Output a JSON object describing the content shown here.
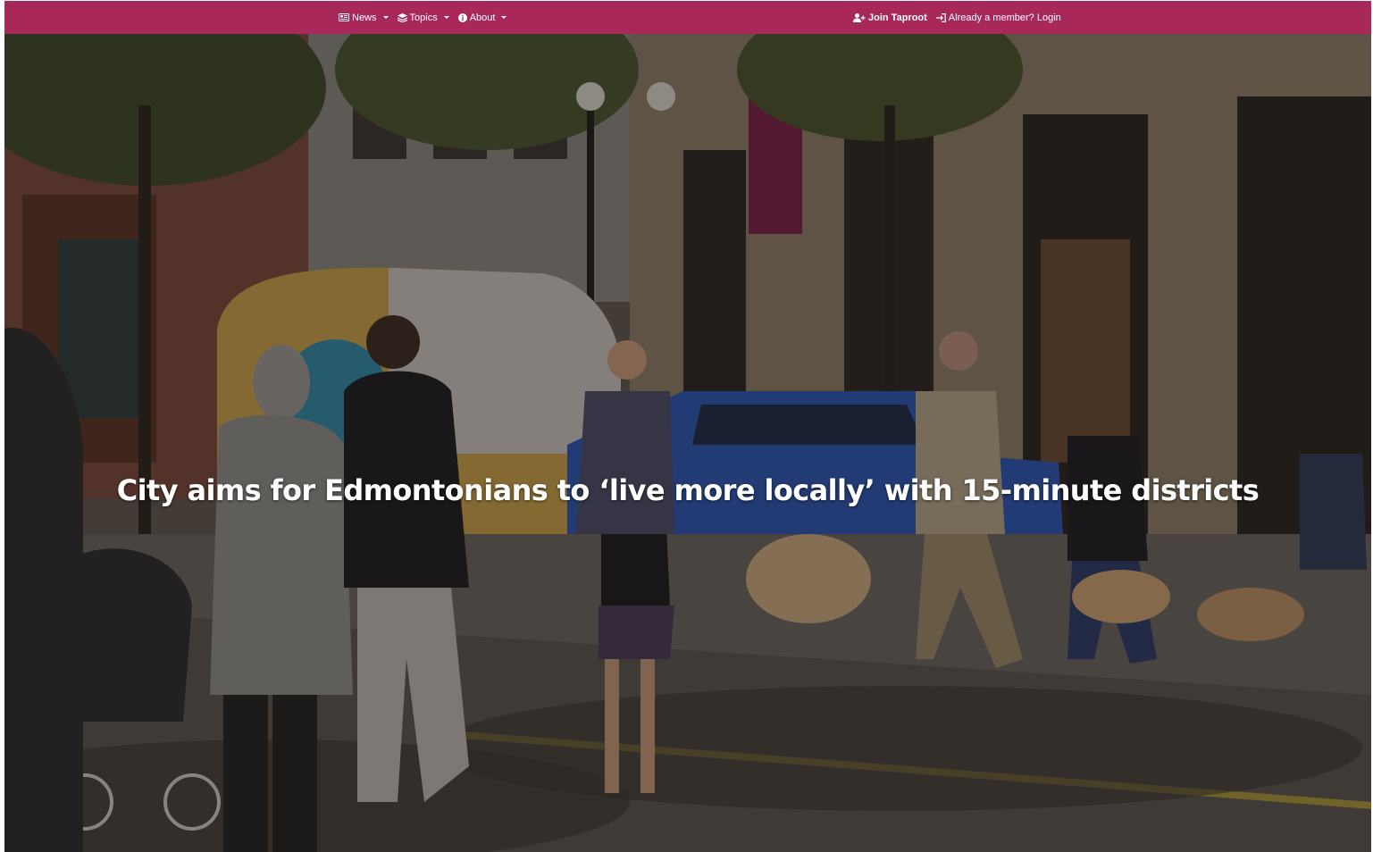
{
  "navbar": {
    "background": "#a8285a",
    "left_items": [
      {
        "label": "News",
        "icon": "newspaper-icon"
      },
      {
        "label": "Topics",
        "icon": "layers-icon"
      },
      {
        "label": "About",
        "icon": "info-circle-icon"
      }
    ],
    "join_label": "Join Taproot",
    "join_icon": "user-plus-icon",
    "login_label": "Already a member? Login",
    "login_icon": "sign-in-icon"
  },
  "hero": {
    "title": "City aims for Edmontonians to ‘live more locally’ with 15-minute districts",
    "image_description_icon": "street-photo"
  }
}
